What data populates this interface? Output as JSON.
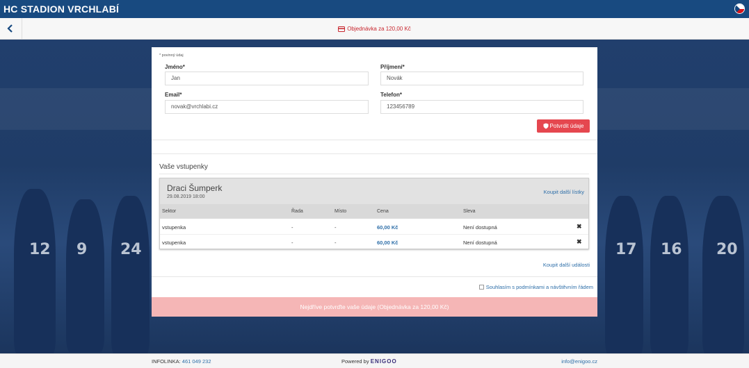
{
  "header": {
    "title": "HC STADION VRCHLABÍ",
    "flag_icon": "czech-flag-icon"
  },
  "subheader": {
    "order_label": "Objednávka za 120,00 Kč",
    "order_icon": "credit-card-icon",
    "back_icon": "chevron-left-icon"
  },
  "form": {
    "required_note": "* povinný údaj",
    "first_name": {
      "label": "Jméno*",
      "value": "Jan"
    },
    "last_name": {
      "label": "Příjmení*",
      "value": "Novák"
    },
    "email": {
      "label": "Email*",
      "value": "novak@vrchlabi.cz"
    },
    "phone": {
      "label": "Telefon*",
      "value": "123456789"
    },
    "confirm_button": "Potvrdit údaje"
  },
  "tickets": {
    "section_title": "Vaše vstupenky",
    "event": {
      "name": "Draci Šumperk",
      "date": "29.08.2019 18:00",
      "buy_more": "Koupit další lístky"
    },
    "columns": [
      "Sektor",
      "Řada",
      "Místo",
      "Cena",
      "Sleva"
    ],
    "rows": [
      {
        "sector": "vstupenka",
        "row": "-",
        "seat": "-",
        "price": "60,00 Kč",
        "discount": "Není dostupná",
        "remove": "✖"
      },
      {
        "sector": "vstupenka",
        "row": "-",
        "seat": "-",
        "price": "60,00 Kč",
        "discount": "Není dostupná",
        "remove": "✖"
      }
    ],
    "more_events": "Koupit další události"
  },
  "agreement": {
    "label": "Souhlasím s podmínkami a návštěvním řádem",
    "checked": false
  },
  "submit_button": "Nejdříve potvrďte vaše údaje (Objednávka za 120,00 Kč)",
  "footer": {
    "infoline_label": "INFOLINKA:",
    "infoline_phone": "461 049 232",
    "powered_label": "Powered by",
    "powered_brand": "ENIGOO",
    "email": "info@enigoo.cz"
  },
  "colors": {
    "brand": "#184a80",
    "accent": "#e5474f",
    "link": "#2d6ea8",
    "submit_disabled": "#f5b6b6"
  }
}
